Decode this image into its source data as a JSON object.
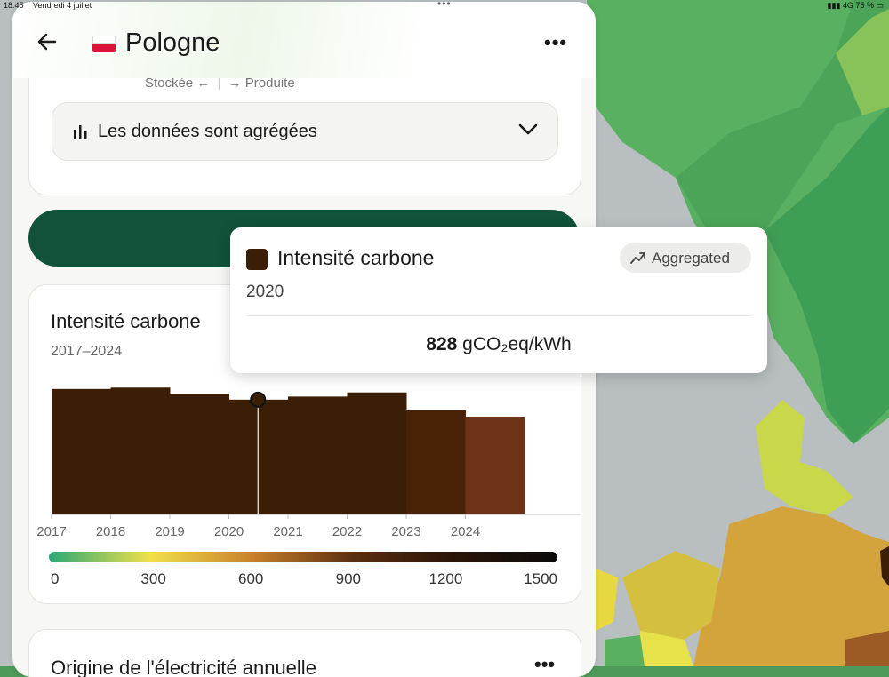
{
  "status_bar": {
    "time": "18:45",
    "date": "Vendredi 4 juillet",
    "network": "4G",
    "battery": "75 %"
  },
  "header": {
    "back_icon": "arrow-left-icon",
    "flag_icon": "poland-flag-icon",
    "title": "Pologne",
    "more_icon": "more-dots-icon"
  },
  "storage": {
    "stored_label": "Stockée",
    "produced_label": "Produite"
  },
  "aggregation": {
    "icon": "bar-chart-icon",
    "label": "Les données sont agrégées",
    "chevron": "chevron-down-icon"
  },
  "chart_card": {
    "title": "Intensité carbone",
    "range": "2017–2024"
  },
  "chart_data": {
    "type": "bar",
    "categories": [
      "2017",
      "2018",
      "2019",
      "2020",
      "2021",
      "2022",
      "2023",
      "2024"
    ],
    "values": [
      905,
      915,
      870,
      828,
      850,
      880,
      750,
      705
    ],
    "ylim": [
      0,
      1000
    ],
    "y_ticks": [
      "0",
      "200",
      "400",
      "600",
      "800",
      "1000"
    ],
    "x_ticks": [
      "2017",
      "2018",
      "2019",
      "2020",
      "2021",
      "2022",
      "2023",
      "2024"
    ],
    "selected_index": 3,
    "bar_colors": [
      "#3a1e06",
      "#3a1e06",
      "#3a1e06",
      "#3a1e06",
      "#3a1e06",
      "#3a1e06",
      "#4a2208",
      "#6e3218"
    ],
    "colorscale": {
      "ticks": [
        "0",
        "300",
        "600",
        "900",
        "1200",
        "1500"
      ],
      "colors": [
        "#2aa876",
        "#f0e04a",
        "#c8802a",
        "#5a2e10",
        "#2a1408",
        "#0a0a0a"
      ]
    }
  },
  "tooltip": {
    "title": "Intensité carbone",
    "badge": "Aggregated",
    "badge_icon": "trend-icon",
    "year": "2020",
    "value": "828",
    "unit": "gCO₂eq/kWh",
    "color": "#3a1e06"
  },
  "next_card": {
    "title": "Origine de l'électricité annuelle"
  }
}
